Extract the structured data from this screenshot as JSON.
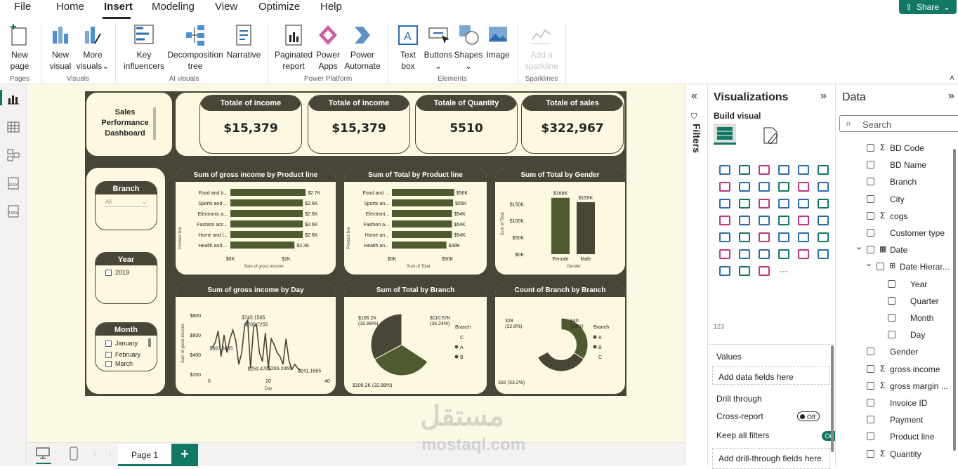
{
  "menu": {
    "file": "File",
    "home": "Home",
    "insert": "Insert",
    "modeling": "Modeling",
    "view": "View",
    "optimize": "Optimize",
    "help": "Help",
    "share": "Share"
  },
  "ribbon": {
    "new_page_1": "New",
    "new_page_2": "page",
    "new_visual_1": "New",
    "new_visual_2": "visual",
    "more_visuals_1": "More",
    "more_visuals_2": "visuals",
    "key_inf_1": "Key",
    "key_inf_2": "influencers",
    "decomp_1": "Decomposition",
    "decomp_2": "tree",
    "narrative": "Narrative",
    "paginated_1": "Paginated",
    "paginated_2": "report",
    "powerapps_1": "Power",
    "powerapps_2": "Apps",
    "powerauto_1": "Power",
    "powerauto_2": "Automate",
    "textbox_1": "Text",
    "textbox_2": "box",
    "buttons": "Buttons",
    "shapes": "Shapes",
    "image": "Image",
    "sparkline_1": "Add a",
    "sparkline_2": "sparkline",
    "g_pages": "Pages",
    "g_visuals": "Visuals",
    "g_ai": "AI visuals",
    "g_platform": "Power Platform",
    "g_elements": "Elements",
    "g_sparklines": "Sparklines"
  },
  "dashboard": {
    "title_1": "Sales",
    "title_2": "Performance",
    "title_3": "Dashboard",
    "kpis": [
      {
        "label": "Totale of income",
        "value": "$15,379"
      },
      {
        "label": "Totale of income",
        "value": "$15,379"
      },
      {
        "label": "Totale of Quantity",
        "value": "5510"
      },
      {
        "label": "Totale of sales",
        "value": "$322,967"
      }
    ],
    "slicers": {
      "branch": "Branch",
      "branch_value": "All",
      "year": "Year",
      "year_item": "2019",
      "month": "Month",
      "month_items": [
        "January",
        "February",
        "March"
      ]
    }
  },
  "chart_data": [
    {
      "type": "bar",
      "title": "Sum of gross income by Product line",
      "xlabel": "Sum of gross income",
      "ylabel": "Product line",
      "categories": [
        "Food and b...",
        "Sports and ...",
        "Electronic a...",
        "Fashion acc...",
        "Home and l...",
        "Health and ..."
      ],
      "values": [
        2.7,
        2.6,
        2.6,
        2.6,
        2.6,
        2.3
      ],
      "data_labels": [
        "$2.7K",
        "$2.6K",
        "$2.6K",
        "$2.6K",
        "$2.6K",
        "$2.3K"
      ],
      "xticks": [
        "$0K",
        "$2K"
      ],
      "xlim": [
        0,
        2.9
      ]
    },
    {
      "type": "bar",
      "title": "Sum of Total by Product line",
      "xlabel": "Sum of Total",
      "ylabel": "Product line",
      "categories": [
        "Food and ...",
        "Sports an...",
        "Electroni...",
        "Fashion a...",
        "Home an...",
        "Health an..."
      ],
      "values": [
        56,
        55,
        54,
        54,
        54,
        49
      ],
      "data_labels": [
        "$56K",
        "$55K",
        "$54K",
        "$54K",
        "$54K",
        "$49K"
      ],
      "xticks": [
        "$0K",
        "$50K"
      ],
      "xlim": [
        0,
        60
      ]
    },
    {
      "type": "bar",
      "title": "Sum of Total by Gender",
      "xlabel": "Gender",
      "ylabel": "Sum of Total",
      "categories": [
        "Female",
        "Male"
      ],
      "values": [
        168,
        155
      ],
      "data_labels": [
        "$168K",
        "$155K"
      ],
      "yticks": [
        "$0K",
        "$50K",
        "$100K",
        "$150K"
      ],
      "ylim": [
        0,
        180
      ]
    },
    {
      "type": "line",
      "title": "Sum of gross income by Day",
      "xlabel": "Day",
      "ylabel": "Sum of gross income",
      "x": [
        1,
        2,
        3,
        4,
        5,
        6,
        7,
        8,
        9,
        10,
        11,
        12,
        13,
        14,
        15,
        16,
        17,
        18,
        19,
        20,
        21,
        22,
        23,
        24,
        25,
        26,
        27,
        28,
        29,
        30,
        31
      ],
      "y": [
        470,
        520,
        640,
        380,
        600,
        420,
        560,
        650,
        540,
        300,
        420,
        700,
        750,
        260,
        680,
        709,
        420,
        330,
        620,
        265,
        560,
        500,
        420,
        380,
        300,
        560,
        340,
        250,
        300,
        260,
        241
      ],
      "annotations": [
        "$708.7255",
        "$745.1505",
        "$467.8935",
        "$259.4785",
        "$265.2065",
        "$241.1665"
      ],
      "yticks": [
        "$200",
        "$400",
        "$600",
        "$800"
      ],
      "xticks": [
        "0",
        "20",
        "40"
      ],
      "ylim": [
        200,
        800
      ],
      "xlim": [
        0,
        40
      ]
    },
    {
      "type": "pie",
      "title": "Sum of Total by Branch",
      "legend_title": "Branch",
      "legend": [
        "C",
        "A",
        "B"
      ],
      "slices": [
        {
          "label": "C",
          "value": 110.57,
          "text": "$110.57K (34.24%)"
        },
        {
          "label": "A",
          "value": 106.2,
          "text": "$106.2K (32.88%)"
        },
        {
          "label": "B",
          "value": 106.2,
          "text": "$106.2K (32.88%)"
        }
      ]
    },
    {
      "type": "pie",
      "title": "Count of Branch by Branch",
      "legend_title": "Branch",
      "legend": [
        "A",
        "B",
        "C"
      ],
      "slices": [
        {
          "label": "A",
          "value": 340,
          "text": "340 (34%)"
        },
        {
          "label": "B",
          "value": 332,
          "text": "332 (33.2%)"
        },
        {
          "label": "C",
          "value": 328,
          "text": "328 (32.8%)"
        }
      ]
    }
  ],
  "visualizations": {
    "title": "Visualizations",
    "build": "Build visual",
    "values": "Values",
    "add_fields": "Add data fields here",
    "drill": "Drill through",
    "cross": "Cross-report",
    "cross_state": "Off",
    "keep": "Keep all filters",
    "keep_state": "On",
    "add_drill": "Add drill-through fields here",
    "more": "···",
    "filters": "Filters"
  },
  "data": {
    "title": "Data",
    "search": "Search",
    "fields": [
      "BD Code",
      "BD Name",
      "Branch",
      "City",
      "cogs",
      "Customer type",
      "Date",
      "Date Hierar...",
      "Year",
      "Quarter",
      "Month",
      "Day",
      "Gender",
      "gross income",
      "gross margin ...",
      "Invoice ID",
      "Payment",
      "Product line",
      "Quantity"
    ]
  },
  "page": {
    "tab": "Page 1",
    "add": "+"
  },
  "colors": {
    "accent": "#117865",
    "dark": "#4a4637",
    "olive": "#4f5a2e",
    "cream": "#fdf8e1",
    "canvas": "#fbf8e3"
  }
}
